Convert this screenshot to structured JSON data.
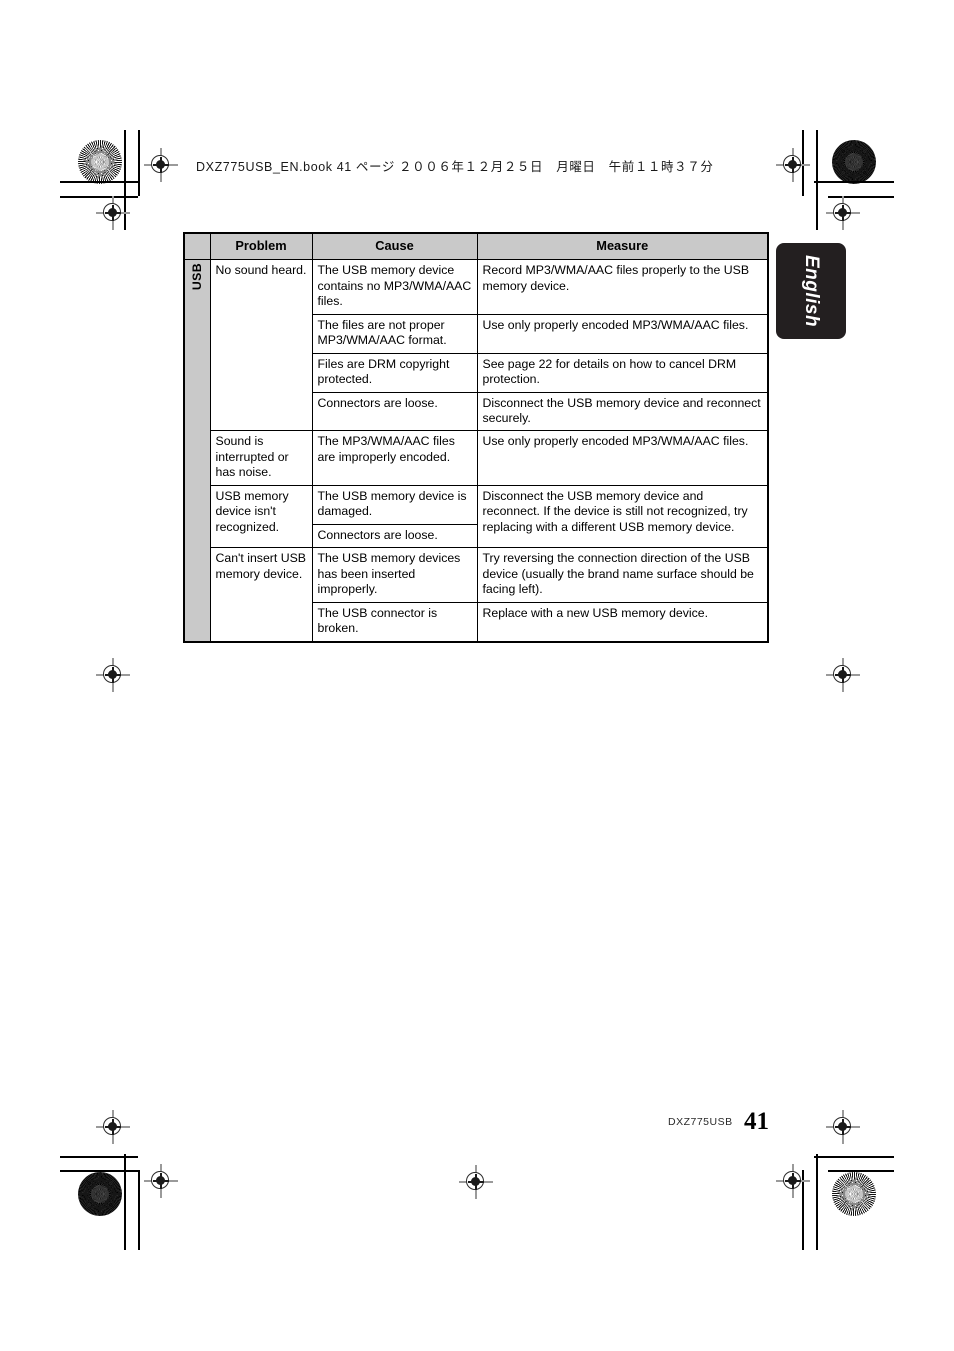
{
  "page": {
    "file_header": "DXZ775USB_EN.book  41 ページ  ２００６年１２月２５日　月曜日　午前１１時３７分",
    "side_tab_label": "English",
    "footer_model": "DXZ775USB",
    "footer_page_number": "41"
  },
  "table": {
    "headers": {
      "category": "",
      "problem": "Problem",
      "cause": "Cause",
      "measure": "Measure"
    },
    "category_label": "USB",
    "rows": [
      {
        "problem": "No sound heard.",
        "cause": "The USB memory device contains no MP3/WMA/AAC files.",
        "measure": "Record MP3/WMA/AAC files properly to the USB memory device."
      },
      {
        "problem": "",
        "cause": "The files are not proper MP3/WMA/AAC format.",
        "measure": "Use only properly encoded MP3/WMA/AAC files."
      },
      {
        "problem": "",
        "cause": "Files are DRM copyright protected.",
        "measure": "See page 22 for details on how to cancel DRM protection."
      },
      {
        "problem": "",
        "cause": "Connectors are loose.",
        "measure": "Disconnect the USB memory device and reconnect securely."
      },
      {
        "problem": "Sound is interrupted or has noise.",
        "cause": "The MP3/WMA/AAC files are improperly encoded.",
        "measure": "Use only properly encoded MP3/WMA/AAC files."
      },
      {
        "problem": "USB memory device isn't recognized.",
        "cause": "The USB memory device is damaged.",
        "measure": "Disconnect the USB memory device and reconnect. If the device is still not recognized, try replacing with a different USB memory device."
      },
      {
        "problem": "",
        "cause": "Connectors are loose.",
        "measure": ""
      },
      {
        "problem": "Can't insert USB memory device.",
        "cause": "The USB memory devices has been inserted improperly.",
        "measure": "Try reversing the connection direction of the USB device (usually the brand name surface should be facing left)."
      },
      {
        "problem": "",
        "cause": "The USB connector is broken.",
        "measure": "Replace with a new USB memory device."
      }
    ]
  },
  "colors": {
    "header_fill": "#c9c9c9",
    "tab_fill": "#231f20",
    "rule": "#000000"
  }
}
